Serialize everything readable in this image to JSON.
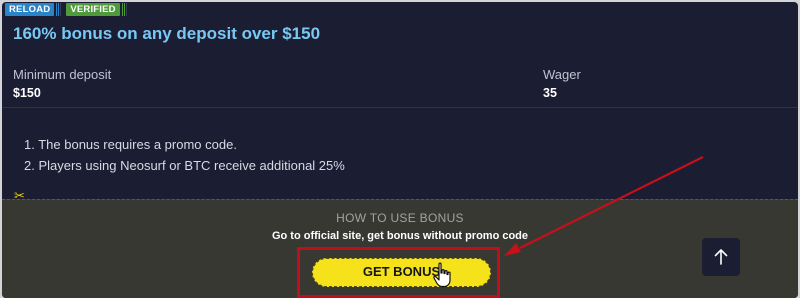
{
  "badges": {
    "reload": "RELOAD",
    "verified": "VERIFIED"
  },
  "offer": {
    "title": "160% bonus on any deposit over $150"
  },
  "stats": {
    "min_deposit_label": "Minimum deposit",
    "min_deposit_value": "$150",
    "wager_label": "Wager",
    "wager_value": "35"
  },
  "terms": [
    "1. The bonus requires a promo code.",
    "2. Players using Neosurf or BTC receive additional 25%"
  ],
  "how_to": {
    "title": "HOW TO USE BONUS",
    "subtitle": "Go to official site, get bonus without promo code",
    "button_label": "GET BONUS"
  },
  "icons": {
    "scissors": "scissors-icon",
    "hand": "pointer-hand-icon",
    "up": "arrow-up-icon"
  },
  "colors": {
    "card_bg": "#1b1d33",
    "title": "#79c8f4",
    "reload_badge": "#2a85c8",
    "verified_badge": "#4f9a3a",
    "howto_bg": "#373832",
    "button": "#f6e21a",
    "highlight": "#c00f1a"
  }
}
